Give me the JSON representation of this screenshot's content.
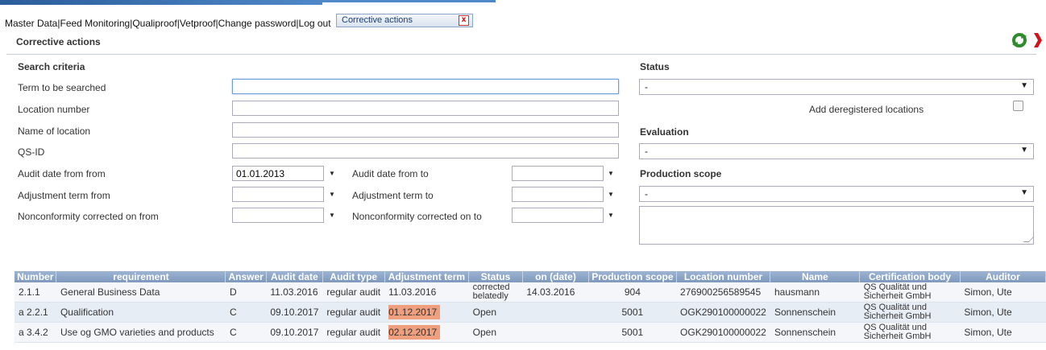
{
  "menu": {
    "master_data": "Master Data",
    "feed_monitoring": "Feed Monitoring",
    "qualiproof": "Qualiproof",
    "vetproof": "Vetproof",
    "change_password": "Change password",
    "log_out": "Log out",
    "separator": "|"
  },
  "tab": {
    "label": "Corrective actions",
    "close": "x"
  },
  "page_title": "Corrective actions",
  "search": {
    "heading": "Search criteria",
    "term_label": "Term to be searched",
    "term_value": "",
    "location_number_label": "Location number",
    "location_number_value": "",
    "location_name_label": "Name of location",
    "location_name_value": "",
    "qsid_label": "QS-ID",
    "qsid_value": "",
    "audit_from_label": "Audit date from from",
    "audit_from_value": "01.01.2013",
    "audit_to_label": "Audit date from to",
    "audit_to_value": "",
    "adj_from_label": "Adjustment term from",
    "adj_from_value": "",
    "adj_to_label": "Adjustment term to",
    "adj_to_value": "",
    "nc_from_label": "Nonconformity corrected on from",
    "nc_from_value": "",
    "nc_to_label": "Nonconformity corrected on to",
    "nc_to_value": "",
    "dropdown_arrow": "▼"
  },
  "status": {
    "heading": "Status",
    "value": "-",
    "deregistered_label": "Add deregistered locations",
    "deregistered_checked": false
  },
  "evaluation": {
    "heading": "Evaluation",
    "value": "-"
  },
  "production_scope": {
    "heading": "Production scope",
    "value": "-"
  },
  "table": {
    "columns": [
      "Number",
      "requirement",
      "Answer",
      "Audit date",
      "Audit type",
      "Adjustment term",
      "Status",
      "on (date)",
      "Production scope",
      "Location number",
      "Name",
      "Certification body",
      "Auditor"
    ],
    "rows": [
      {
        "number": "2.1.1",
        "requirement": "General Business Data",
        "answer": "D",
        "audit_date": "11.03.2016",
        "audit_type": "regular audit",
        "adjustment_term": "11.03.2016",
        "adj_overdue": false,
        "status": "corrected belatedly",
        "on_date": "14.03.2016",
        "production_scope": "904",
        "location_number": "276900256589545",
        "name": "hausmann",
        "cert_body": "QS Qualität und Sicherheit GmbH",
        "auditor": "Simon, Ute"
      },
      {
        "number": "a 2.2.1",
        "requirement": "Qualification",
        "answer": "C",
        "audit_date": "09.10.2017",
        "audit_type": "regular audit",
        "adjustment_term": "01.12.2017",
        "adj_overdue": true,
        "status": "Open",
        "on_date": "",
        "production_scope": "5001",
        "location_number": "OGK290100000022",
        "name": "Sonnenschein",
        "cert_body": "QS Qualität und Sicherheit GmbH",
        "auditor": "Simon, Ute"
      },
      {
        "number": "a 3.4.2",
        "requirement": "Use og GMO varieties and products",
        "answer": "C",
        "audit_date": "09.10.2017",
        "audit_type": "regular audit",
        "adjustment_term": "02.12.2017",
        "adj_overdue": true,
        "status": "Open",
        "on_date": "",
        "production_scope": "5001",
        "location_number": "OGK290100000022",
        "name": "Sonnenschein",
        "cert_body": "QS Qualität und Sicherheit GmbH",
        "auditor": "Simon, Ute"
      }
    ]
  },
  "colors": {
    "header_bg": "#8aa3c6",
    "overdue": "#ef9f7d",
    "refresh_icon": "#2e8b2e",
    "exit_icon": "#d0151b"
  },
  "icons": {
    "refresh": "refresh-icon",
    "exit": "exit-icon"
  }
}
